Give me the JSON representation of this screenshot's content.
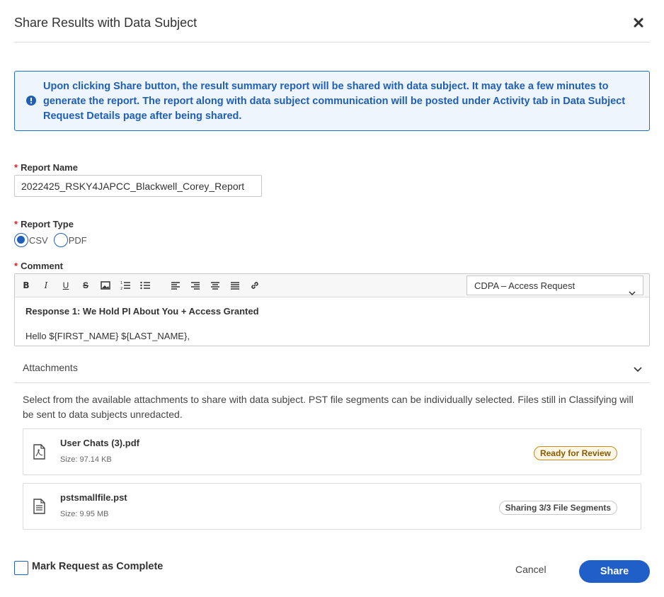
{
  "dialog": {
    "title": "Share Results with Data Subject",
    "close_icon": "close-icon"
  },
  "banner": {
    "icon": "info-icon",
    "message": "Upon clicking Share button, the result summary report will be shared with data subject. It may take a few minutes to generate the report. The report along with data subject communication will be posted under Activity tab in Data Subject Request Details page after being shared.",
    "color": "#1f5fb7"
  },
  "form": {
    "required_mark": "*",
    "report_name_label": "Report Name",
    "report_name_value": "2022425_RSKY4JAPCC_Blackwell_Corey_Report",
    "report_type_label": "Report Type",
    "report_type_options": [
      "CSV",
      "PDF"
    ],
    "report_type_selected": "CSV",
    "comment_label": "Comment"
  },
  "editor": {
    "toolbar_icons": [
      "bold-icon",
      "italic-icon",
      "underline-icon",
      "strikethrough-icon",
      "image-icon",
      "ordered-list-icon",
      "unordered-list-icon",
      "align-left-icon",
      "align-center-icon",
      "align-right-icon",
      "align-justify-icon",
      "link-icon"
    ],
    "toolbar_glyphs": {
      "bold": "B",
      "italic": "I",
      "underline": "U",
      "strike": "S"
    },
    "template_selected": "CDPA – Access Request",
    "body_heading": "Response 1: We Hold PI About You + Access Granted",
    "body_greeting": "Hello ${FIRST_NAME} ${LAST_NAME},"
  },
  "attachments": {
    "title": "Attachments",
    "description": "Select from the available attachments to share with data subject. PST file segments can be individually selected. Files still in Classifying will be sent to data subjects unredacted.",
    "files": [
      {
        "name": "User Chats (3).pdf",
        "size": "Size: 97.14 KB",
        "icon": "pdf-file-icon",
        "status": "Ready for Review"
      },
      {
        "name": "pstsmallfile.pst",
        "size": "Size: 9.95 MB",
        "icon": "document-file-icon",
        "status": "Sharing 3/3 File Segments"
      }
    ]
  },
  "footer": {
    "mark_complete_label": "Mark Request as Complete",
    "mark_complete_checked": false,
    "cancel_label": "Cancel",
    "share_label": "Share"
  },
  "colors": {
    "accent": "#1f5fc7",
    "required": "#dd2222",
    "review_badge": "#c58a1d"
  }
}
